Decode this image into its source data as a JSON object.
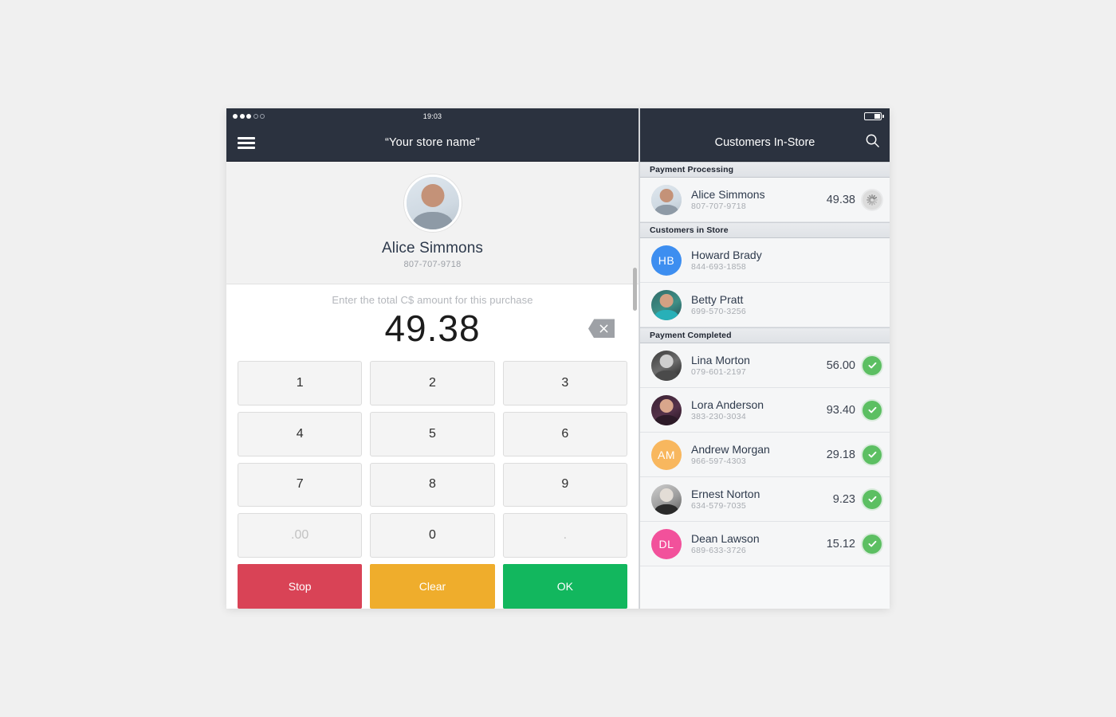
{
  "left": {
    "status": {
      "time": "19:03",
      "signal_filled": 3,
      "signal_empty": 2
    },
    "nav": {
      "menu_icon": "hamburger-menu-icon",
      "store_title": "“Your store name”"
    },
    "customer": {
      "name": "Alice Simmons",
      "phone": "807-707-9718",
      "avatar": "alice-photo"
    },
    "amount": {
      "hint": "Enter the total C$ amount for this purchase",
      "value": "49.38",
      "backspace_icon": "backspace-delete-icon"
    },
    "keypad": {
      "keys": [
        {
          "label": "1",
          "style": "num"
        },
        {
          "label": "2",
          "style": "num"
        },
        {
          "label": "3",
          "style": "num"
        },
        {
          "label": "4",
          "style": "num"
        },
        {
          "label": "5",
          "style": "num"
        },
        {
          "label": "6",
          "style": "num"
        },
        {
          "label": "7",
          "style": "num"
        },
        {
          "label": "8",
          "style": "num"
        },
        {
          "label": "9",
          "style": "num"
        },
        {
          "label": ".00",
          "style": "dim"
        },
        {
          "label": "0",
          "style": "num"
        },
        {
          "label": ".",
          "style": "dim"
        },
        {
          "label": "Stop",
          "style": "stop"
        },
        {
          "label": "Clear",
          "style": "clear"
        },
        {
          "label": "OK",
          "style": "ok"
        }
      ]
    }
  },
  "right": {
    "status": {
      "battery_icon": "battery-icon"
    },
    "nav": {
      "title": "Customers In-Store",
      "search_icon": "search-icon"
    },
    "sections": [
      {
        "title": "Payment Processing",
        "rows": [
          {
            "name": "Alice Simmons",
            "phone": "807-707-9718",
            "amount": "49.38",
            "status": "processing",
            "avatar_type": "photo",
            "avatar_class": "ph-alice",
            "initials": ""
          }
        ]
      },
      {
        "title": "Customers in Store",
        "rows": [
          {
            "name": "Howard Brady",
            "phone": "844-693-1858",
            "amount": "",
            "status": "none",
            "avatar_type": "initials",
            "avatar_color": "#3d8ef0",
            "initials": "HB"
          },
          {
            "name": "Betty Pratt",
            "phone": "699-570-3256",
            "amount": "",
            "status": "none",
            "avatar_type": "photo",
            "avatar_class": "ph-betty",
            "initials": ""
          }
        ]
      },
      {
        "title": "Payment Completed",
        "rows": [
          {
            "name": "Lina Morton",
            "phone": "079-601-2197",
            "amount": "56.00",
            "status": "completed",
            "avatar_type": "photo",
            "avatar_class": "ph-lina",
            "initials": ""
          },
          {
            "name": "Lora Anderson",
            "phone": "383-230-3034",
            "amount": "93.40",
            "status": "completed",
            "avatar_type": "photo",
            "avatar_class": "ph-lora",
            "initials": ""
          },
          {
            "name": "Andrew Morgan",
            "phone": "966-597-4303",
            "amount": "29.18",
            "status": "completed",
            "avatar_type": "initials",
            "avatar_color": "#f8b75e",
            "initials": "AM"
          },
          {
            "name": "Ernest Norton",
            "phone": "634-579-7035",
            "amount": "9.23",
            "status": "completed",
            "avatar_type": "photo",
            "avatar_class": "ph-ernest",
            "initials": ""
          },
          {
            "name": "Dean Lawson",
            "phone": "689-633-3726",
            "amount": "15.12",
            "status": "completed",
            "avatar_type": "initials",
            "avatar_color": "#f2519b",
            "initials": "DL"
          }
        ]
      }
    ]
  },
  "colors": {
    "navbar": "#2b323f",
    "stop": "#d94356",
    "clear": "#efad2c",
    "ok": "#12b75e",
    "success": "#5cbf62",
    "page_bg": "#f0f0f0"
  }
}
